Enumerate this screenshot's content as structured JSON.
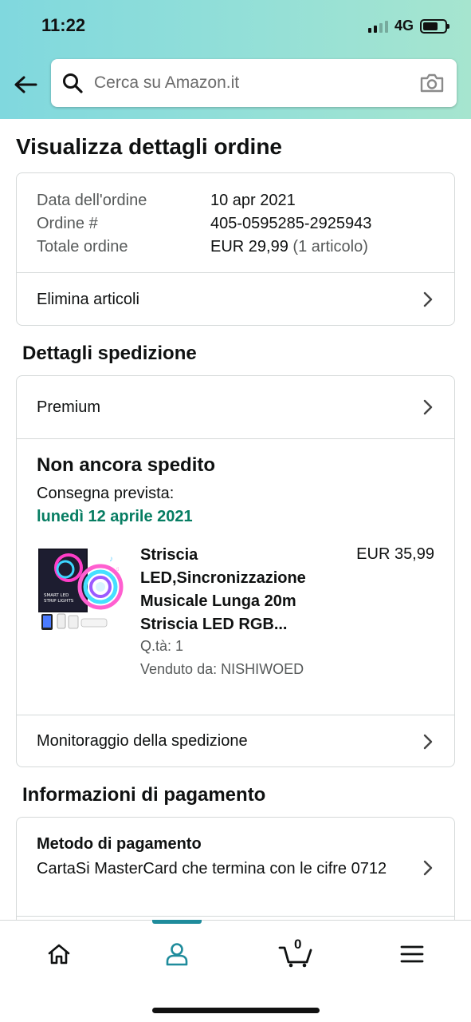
{
  "status_bar": {
    "time": "11:22",
    "network": "4G"
  },
  "header": {
    "back_icon": "arrow-left-icon",
    "search": {
      "placeholder": "Cerca su Amazon.it",
      "icon": "search-icon",
      "camera_icon": "camera-icon"
    }
  },
  "page": {
    "title": "Visualizza dettagli ordine"
  },
  "order_info": {
    "rows": [
      {
        "label": "Data dell'ordine",
        "value": "10 apr 2021",
        "extra": ""
      },
      {
        "label": "Ordine #",
        "value": "405-0595285-2925943",
        "extra": ""
      },
      {
        "label": "Totale ordine",
        "value": "EUR 29,99",
        "extra": "(1 articolo)"
      }
    ],
    "delete_items_label": "Elimina articoli"
  },
  "shipping": {
    "heading": "Dettagli spedizione",
    "method_label": "Premium",
    "status_title": "Non ancora spedito",
    "delivery_label": "Consegna prevista:",
    "delivery_date": "lunedì 12 aprile 2021",
    "accent_color": "#067d62",
    "product": {
      "title": "Striscia LED,Sincronizzazione Musicale Lunga 20m Striscia LED RGB...",
      "price": "EUR 35,99",
      "quantity": "Q.tà: 1",
      "seller": "Venduto da: NISHIWOED",
      "image_text": "SMART LED STRIP LIGHTS"
    },
    "tracking_label": "Monitoraggio della spedizione"
  },
  "payment": {
    "heading": "Informazioni di pagamento",
    "method_label": "Metodo di pagamento",
    "method_value": "CartaSi MasterCard che termina con le cifre 0712"
  },
  "bottom_nav": {
    "items": [
      {
        "name": "home",
        "icon": "home-icon"
      },
      {
        "name": "account",
        "icon": "person-icon",
        "active": true
      },
      {
        "name": "cart",
        "icon": "cart-icon",
        "count": "0"
      },
      {
        "name": "menu",
        "icon": "menu-icon"
      }
    ],
    "active_color": "#1f8c9c"
  }
}
